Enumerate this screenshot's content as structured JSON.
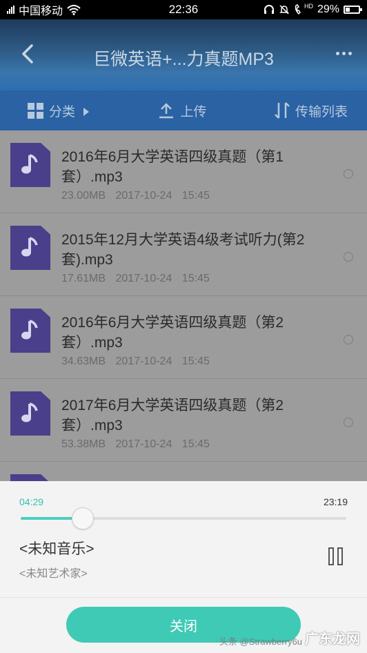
{
  "status_bar": {
    "carrier": "中国移动",
    "time": "22:36",
    "battery": "29%",
    "hd_label": "HD",
    "icons": [
      "signal-icon",
      "wifi-icon",
      "headset-icon",
      "mute-icon",
      "hd-call-icon",
      "battery-icon"
    ]
  },
  "header": {
    "title": "巨微英语+...力真题MP3",
    "back_icon": "back-icon",
    "more_icon": "more-icon"
  },
  "toolbar": {
    "category_label": "分类",
    "upload_label": "上传",
    "transfer_label": "传输列表"
  },
  "files": [
    {
      "name": "2016年6月大学英语四级真题（第1套）.mp3",
      "size": "23.00MB",
      "date": "2017-10-24",
      "time": "15:45"
    },
    {
      "name": "2015年12月大学英语4级考试听力(第2套).mp3",
      "size": "17.61MB",
      "date": "2017-10-24",
      "time": "15:45"
    },
    {
      "name": "2016年6月大学英语四级真题（第2套）.mp3",
      "size": "34.63MB",
      "date": "2017-10-24",
      "time": "15:45"
    },
    {
      "name": "2017年6月大学英语四级真题（第2套）.mp3",
      "size": "53.38MB",
      "date": "2017-10-24",
      "time": "15:45"
    }
  ],
  "player": {
    "current_time": "04:29",
    "total_time": "23:19",
    "progress": 0.19,
    "track_title": "<未知音乐>",
    "artist": "<未知艺术家>",
    "close_label": "关闭",
    "accent_color": "#3fcab6"
  },
  "watermark": {
    "handle": "头条 @Strawberry6u",
    "brand": "广东龙网"
  }
}
